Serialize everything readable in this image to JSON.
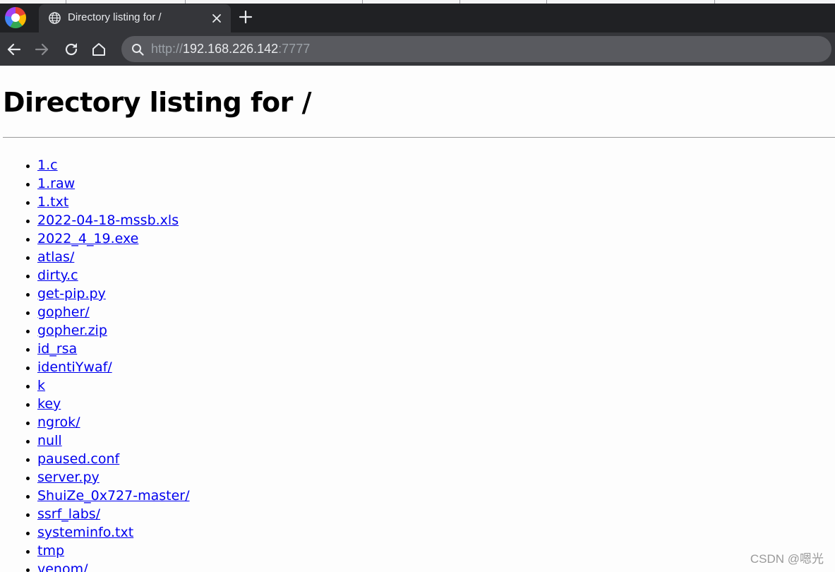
{
  "browser": {
    "tab": {
      "title": "Directory listing for /"
    },
    "address_bar": {
      "scheme": "http://",
      "host": "192.168.226.142",
      "port": ":7777"
    }
  },
  "page": {
    "title": "Directory listing for /",
    "entries": [
      "1.c",
      "1.raw",
      "1.txt",
      "2022-04-18-mssb.xls",
      "2022_4_19.exe",
      "atlas/",
      "dirty.c",
      "get-pip.py",
      "gopher/",
      "gopher.zip",
      "id_rsa",
      "identiYwaf/",
      "k",
      "key",
      "ngrok/",
      "null",
      "paused.conf",
      "server.py",
      "ShuiZe_0x727-master/",
      "ssrf_labs/",
      "systeminfo.txt",
      "tmp",
      "venom/"
    ]
  },
  "watermark": "CSDN @嗯光",
  "colors": {
    "link": "#0000ee",
    "tabstrip_bg": "#202124",
    "toolbar_bg": "#35363a",
    "omnibox_bg": "#595a5f"
  },
  "icons": [
    "browser-logo-icon",
    "globe-icon",
    "close-icon",
    "plus-icon",
    "back-arrow-icon",
    "forward-arrow-icon",
    "reload-icon",
    "home-icon",
    "search-icon"
  ]
}
